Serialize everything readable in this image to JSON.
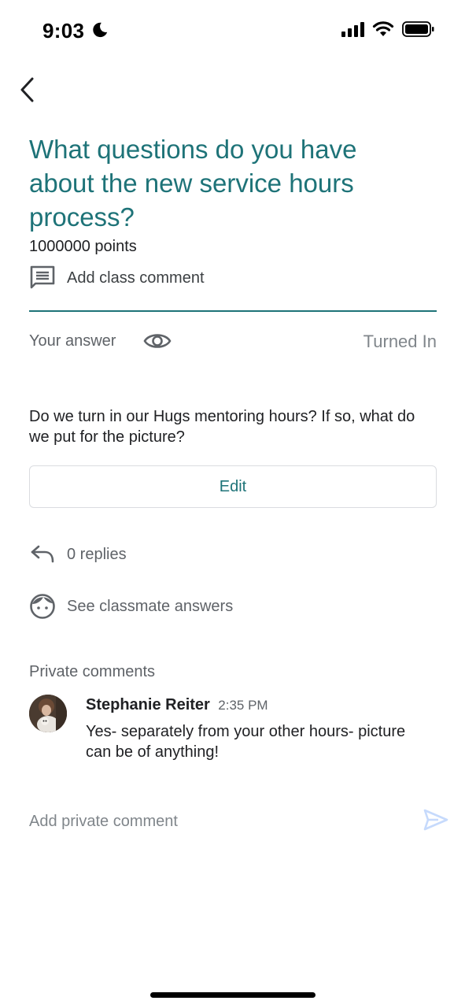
{
  "status_bar": {
    "time": "9:03",
    "icons": [
      "moon-icon",
      "signal-icon",
      "wifi-icon",
      "battery-icon"
    ]
  },
  "nav": {
    "back_icon": "chevron-left-icon"
  },
  "question": {
    "title": "What questions do you have about the new service hours process?",
    "points": "1000000 points",
    "add_class_comment": "Add class comment"
  },
  "answer": {
    "your_answer_label": "Your answer",
    "status": "Turned In",
    "text": "Do we turn in our Hugs mentoring hours? If so, what do we put for the picture?",
    "edit_label": "Edit"
  },
  "replies": {
    "label": "0 replies"
  },
  "classmates": {
    "label": "See classmate answers"
  },
  "private_comments": {
    "heading": "Private comments",
    "comments": [
      {
        "author": "Stephanie Reiter",
        "time": "2:35 PM",
        "text": "Yes- separately from your other hours- picture can be of anything!"
      }
    ],
    "input_placeholder": "Add private comment"
  },
  "colors": {
    "accent": "#1e7378",
    "text_primary": "#202124",
    "text_secondary": "#5f6368",
    "send_disabled": "#c6dafc"
  }
}
